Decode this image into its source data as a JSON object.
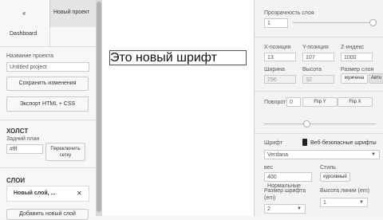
{
  "left_panel": {
    "back_label": "«",
    "tab_project": "Новый проект",
    "tab_dashboard": "Dashboard",
    "project_name_label": "Название проекта",
    "project_name_value": "Untitled project",
    "save_button": "Сохранить изменения",
    "export_button": "Экспорт HTML + CSS",
    "canvas_header": "ХОЛСТ",
    "background_label": "Задний план",
    "background_value": "#fff",
    "toggle_grid_line1": "Переключить",
    "toggle_grid_line2": "сетку",
    "layers_header": "СЛОИ",
    "layer_item": "Новый слой, ...",
    "layer_close": "✕",
    "add_layer_partial": "Добавить новый слой"
  },
  "canvas": {
    "text": "Это новый шрифт"
  },
  "right_panel": {
    "opacity_label": "Прозрачность слоя",
    "opacity_value": "1",
    "opacity_fraction": 1.0,
    "x_label": "X-позиция",
    "x_value": "13",
    "y_label": "Y-позиция",
    "y_value": "107",
    "z_label": "Z-индекс",
    "z_value": "1000",
    "width_label": "Ширина",
    "width_value": "296",
    "height_label": "Высота",
    "height_value": "32",
    "layer_size_label": "Размер слоя",
    "layer_size_value": "мужчина",
    "auto_label": "Авто",
    "rotate_label": "Поворот",
    "rotate_value": "0",
    "flip_y": "Flip Y",
    "flip_x": "Flip X",
    "rotate_fraction": 0.38,
    "font_label": "Шрифт",
    "websafe_label": "Веб-безопасные шрифты",
    "font_value": "Verdana",
    "weight_label": "вес",
    "weight_value": "400 Нормальные",
    "style_label": "Стиль",
    "style_value": "курсивный",
    "font_size_label_1": "Размер шрифта",
    "font_size_label_2": "(em)",
    "font_size_value": "2",
    "line_height_label": "Высота линии (em)",
    "line_height_value": "1"
  }
}
